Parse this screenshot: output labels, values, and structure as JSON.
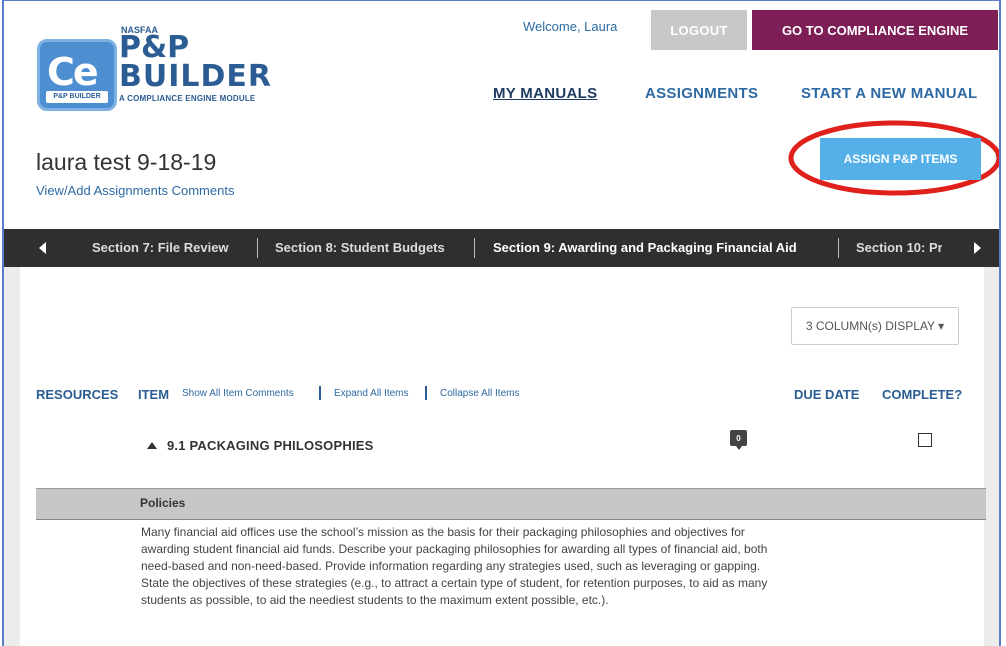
{
  "header": {
    "welcome": "Welcome, Laura",
    "logout_label": "LOGOUT",
    "compliance_label": "GO TO COMPLIANCE ENGINE",
    "logo": {
      "ce": "Ce",
      "badge": "P&P BUILDER",
      "nasfaa": "NASFAA",
      "pp": "P&P",
      "builder": "BUILDER",
      "module": "A COMPLIANCE ENGINE MODULE"
    },
    "nav": [
      "MY MANUALS",
      "ASSIGNMENTS",
      "START A NEW MANUAL"
    ],
    "assign_button": "ASSIGN P&P ITEMS"
  },
  "manual": {
    "title": "laura test 9-18-19",
    "comments_link": "View/Add Assignments Comments"
  },
  "sections": [
    "Section 7: File Review",
    "Section 8: Student Budgets",
    "Section 9: Awarding and Packaging Financial Aid",
    "Section 10: Pr"
  ],
  "active_section_index": 2,
  "column_display": "3 COLUMN(s) DISPLAY ▾",
  "table": {
    "col_resources": "RESOURCES",
    "col_item": "ITEM",
    "show_comments": "Show All Item Comments",
    "expand": "Expand All Items",
    "collapse": "Collapse All Items",
    "col_due": "DUE DATE",
    "col_complete": "COMPLETE?"
  },
  "item": {
    "title": "9.1 PACKAGING PHILOSOPHIES",
    "comment_count": "0",
    "complete": false
  },
  "policies": {
    "label": "Policies",
    "text": "Many financial aid offices use the school’s mission as the basis for their packaging philosophies and objectives for awarding student financial aid funds. Describe your packaging philosophies for awarding all types of financial aid, both need-based and non-need-based. Provide information regarding any strategies used, such as leveraging or gapping. State the objectives of these strategies (e.g., to attract a certain type of student, for retention purposes, to aid as many students as possible, to aid the neediest students to the maximum extent possible, etc.)."
  },
  "colors": {
    "primary_blue": "#2b5c93",
    "compliance_purple": "#7d1f56",
    "assign_blue": "#55b0e8",
    "highlight_red": "#e0201a",
    "section_bar": "#2f2f2f"
  }
}
